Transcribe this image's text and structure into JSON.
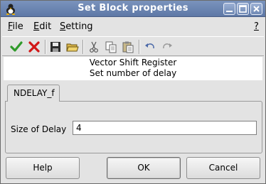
{
  "window": {
    "title": "Set Block properties"
  },
  "menu": {
    "file": "File",
    "edit": "Edit",
    "setting": "Setting",
    "help": "?"
  },
  "toolbar": {
    "icons": [
      "ok-check-icon",
      "cancel-x-icon",
      "save-icon",
      "open-folder-icon",
      "cut-icon",
      "copy-icon",
      "paste-icon",
      "undo-icon",
      "redo-icon"
    ]
  },
  "description": {
    "line1": "Vector Shift Register",
    "line2": "Set number of delay"
  },
  "tab": {
    "label": "NDELAY_f"
  },
  "form": {
    "label": "Size of Delay",
    "value": "4"
  },
  "buttons": {
    "help": "Help",
    "ok": "OK",
    "cancel": "Cancel"
  },
  "colors": {
    "titlebar": "#6a84b0",
    "ok_check": "#2f9a2a",
    "cancel_x": "#d11616"
  }
}
